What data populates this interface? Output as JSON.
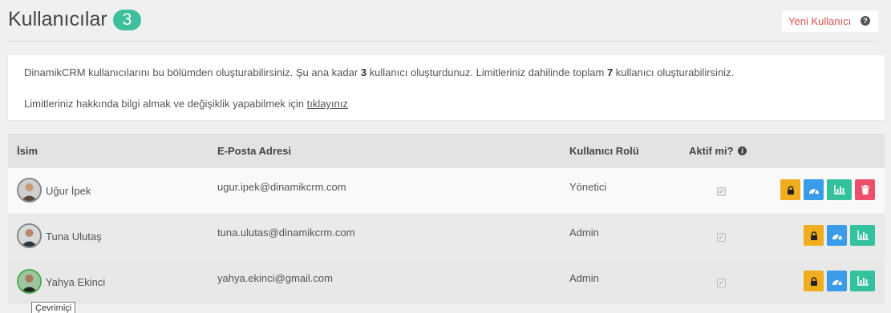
{
  "header": {
    "title": "Kullanıcılar",
    "count": "3",
    "new_user_label": "Yeni Kullanıcı",
    "help_icon": "question-circle-icon"
  },
  "info": {
    "text1_a": "DinamikCRM kullanıcılarını bu bölümden oluşturabilirsiniz. Şu ana kadar ",
    "text1_b": "3",
    "text1_c": " kullanıcı oluşturdunuz. Limitleriniz dahilinde toplam ",
    "text1_d": "7",
    "text1_e": " kullanıcı oluşturabilirsiniz.",
    "text2": "Limitleriniz hakkında bilgi almak ve değişiklik yapabilmek için ",
    "link": "tıklayınız"
  },
  "table": {
    "headers": {
      "name": "İsim",
      "email": "E-Posta Adresi",
      "role": "Kullanıcı Rolü",
      "active": "Aktif mi?"
    },
    "rows": [
      {
        "name": "Uğur İpek",
        "email": "ugur.ipek@dinamikcrm.com",
        "role": "Yönetici",
        "active": true
      },
      {
        "name": "Tuna Ulutaş",
        "email": "tuna.ulutas@dinamikcrm.com",
        "role": "Admin",
        "active": true
      },
      {
        "name": "Yahya Ekinci",
        "email": "yahya.ekinci@gmail.com",
        "role": "Admin",
        "active": true
      }
    ]
  },
  "tooltip": "Çevrimiçi",
  "colors": {
    "accent": "#3fbf9e",
    "lock": "#f0ad1e",
    "dashboard": "#3a9be8",
    "stats": "#33c19e",
    "delete": "#ee4f6a",
    "link_red": "#d9534f"
  }
}
